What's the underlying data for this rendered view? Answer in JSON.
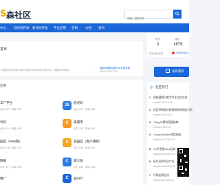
{
  "header": {
    "logo_mark": "S",
    "site_name": "森社区",
    "search_placeholder": "请输入搜索内容"
  },
  "nav": {
    "items": [
      {
        "label": "中心"
      },
      {
        "label": "低代码开发"
      },
      {
        "label": "易代码开发"
      },
      {
        "label": "平台应用"
      },
      {
        "label": "咨询"
      },
      {
        "label": "文档"
      },
      {
        "label": "资讯"
      }
    ]
  },
  "user_stats": {
    "items": [
      {
        "label": "积分",
        "value": "0"
      },
      {
        "label": "经验",
        "value": "1879"
      }
    ],
    "phone_label": "联系电话号码",
    "phone_value": "1890001111"
  },
  "publish_button": "发布需求",
  "announce": {
    "title": "发布",
    "desc": "一款面向开发者和Ping开发者的SaaS低代码开发平台，请随时访问体验。",
    "note_line1": "智能化数据加载平台来结合新",
    "note_line2": "2025-7-14 07:29"
  },
  "section_label": "应用",
  "apps": [
    {
      "name": "低代码",
      "meta": "点击 1297  · 阅读 1593",
      "icon_text": "JS",
      "color": "#2d7be6"
    },
    {
      "name": "森城市",
      "meta": "点击 1254  · 阅读 1601",
      "icon_text": "C",
      "color": "#f59a23"
    },
    {
      "name": "森园区（客户端版）",
      "meta": "点击 1268  · 阅读 1617",
      "icon_text": "6",
      "color": "#f5a623"
    },
    {
      "name": "森大屏",
      "meta": "点击 1140  · 阅读 1405",
      "icon_text": "C",
      "color": "#2d7be6"
    },
    {
      "name": "森兴行",
      "meta": "点击 1082  · 阅读 1287",
      "icon_text": "C",
      "color": "#1b66d8"
    }
  ],
  "left_labels": [
    {
      "name": "工厂平台",
      "meta": "点击 1287  · 阅读 1537"
    },
    {
      "name": "代码",
      "meta": "点击 1151  · 阅读 1480"
    },
    {
      "name": "园区（Web版）",
      "meta": "点击 1196  · 阅读 1420"
    },
    {
      "name": "数据",
      "meta": "点击 1077  · 阅读 1260"
    },
    {
      "name": "数厂",
      "meta": "点击 1032  · 阅读 1194"
    }
  ],
  "community": {
    "title": "社区热门",
    "items": [
      {
        "rank": "1",
        "text": "智能建模与数字孪生应用方案",
        "meta": "smooth 2025-6-25"
      },
      {
        "rank": "2",
        "text": "低层环数据仿真数据智能调度分析",
        "meta": "smooth 2025-6-10"
      },
      {
        "rank": "3",
        "text": "Thing20模块搭建指南",
        "meta": "smooth 2025-6-9"
      },
      {
        "rank": "4",
        "text": "CompoBuilder 使用指南",
        "meta": "samplerail 2025-5-30"
      },
      {
        "rank": "5",
        "text": "1.0开发版Java及其",
        "meta": "samplerail 2025-5-13"
      },
      {
        "rank": "6",
        "text": "低代码中项目介绍",
        "meta": "samplerail 2025-5-13"
      },
      {
        "rank": "7",
        "text": "代码起源在线",
        "meta": "samplerail 2025-5-6"
      }
    ]
  },
  "colors": {
    "primary": "#1b66d8",
    "accent": "#f5a200"
  }
}
